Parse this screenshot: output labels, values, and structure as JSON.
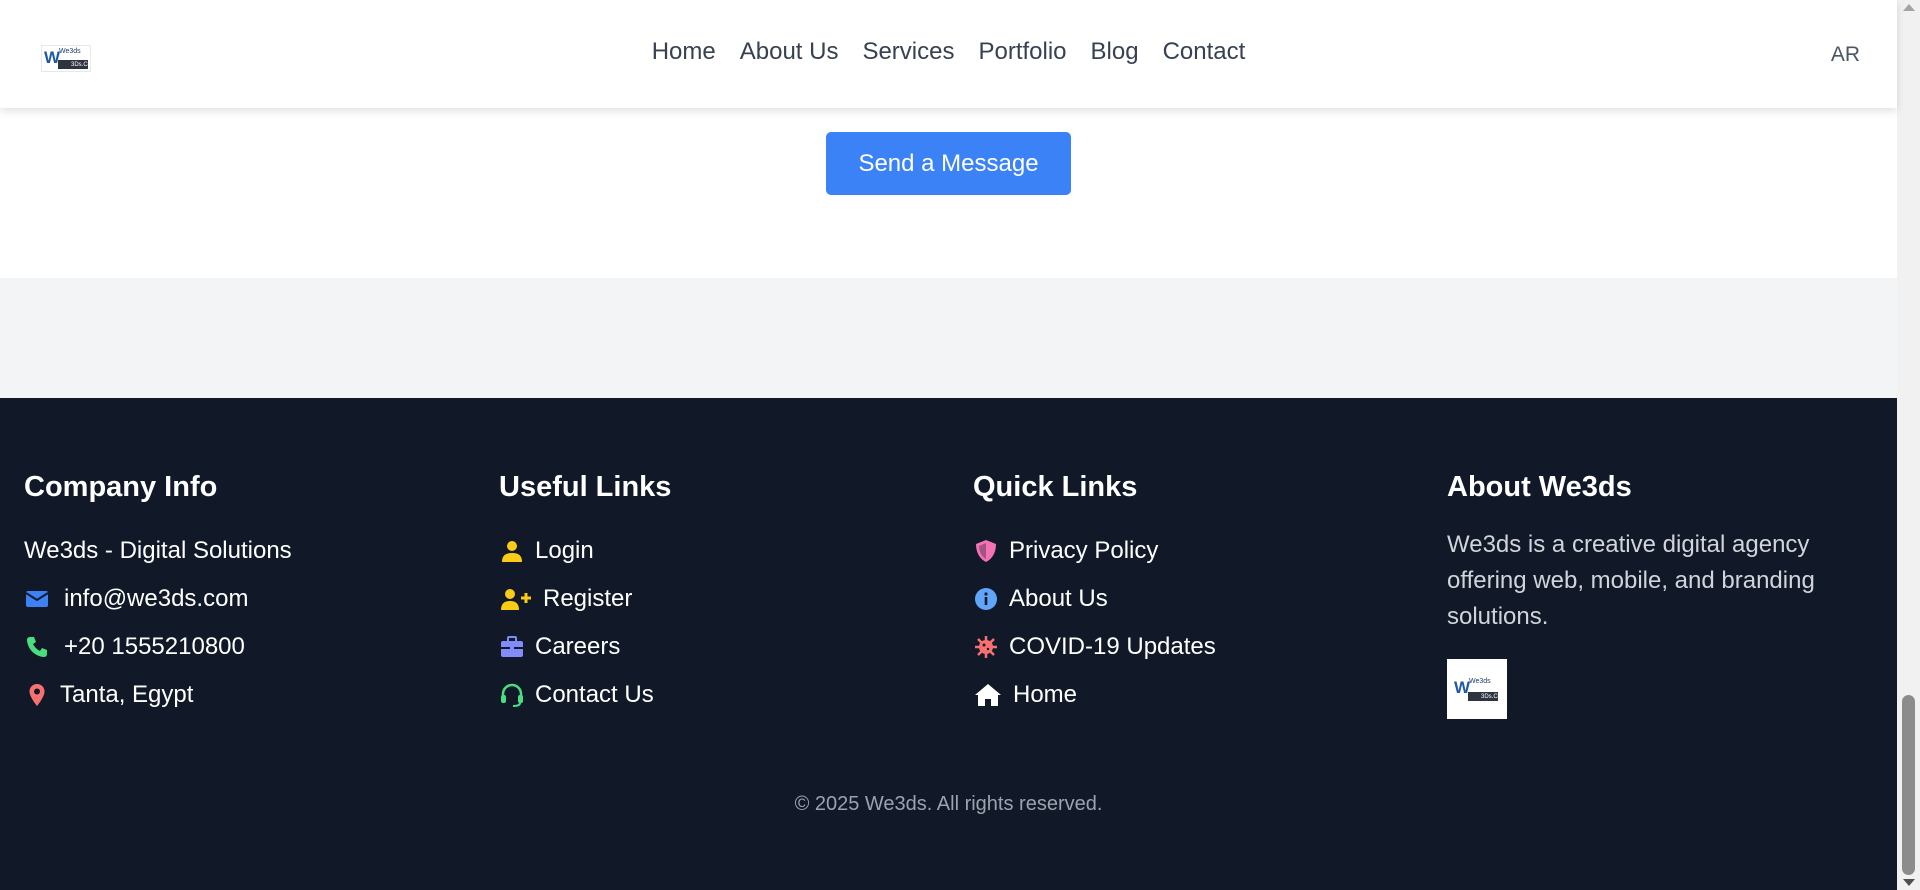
{
  "header": {
    "logo_text": "We3ds",
    "logo_sub": "3Ds.Co",
    "nav": [
      {
        "label": "Home"
      },
      {
        "label": "About Us"
      },
      {
        "label": "Services"
      },
      {
        "label": "Portfolio"
      },
      {
        "label": "Blog"
      },
      {
        "label": "Contact"
      }
    ],
    "lang_toggle": "AR"
  },
  "contact": {
    "send_label": "Send a Message"
  },
  "footer": {
    "company": {
      "title": "Company Info",
      "name": "We3ds - Digital Solutions",
      "email": "info@we3ds.com",
      "phone": "+20 1555210800",
      "location": "Tanta, Egypt"
    },
    "useful": {
      "title": "Useful Links",
      "items": [
        {
          "label": "Login",
          "icon": "user-icon"
        },
        {
          "label": "Register",
          "icon": "user-plus-icon"
        },
        {
          "label": "Careers",
          "icon": "briefcase-icon"
        },
        {
          "label": "Contact Us",
          "icon": "headset-icon"
        }
      ]
    },
    "quick": {
      "title": "Quick Links",
      "items": [
        {
          "label": "Privacy Policy",
          "icon": "shield-icon"
        },
        {
          "label": "About Us",
          "icon": "info-icon"
        },
        {
          "label": "COVID-19 Updates",
          "icon": "virus-icon"
        },
        {
          "label": "Home",
          "icon": "home-icon"
        }
      ]
    },
    "about": {
      "title": "About We3ds",
      "text": "We3ds is a creative digital agency offering web, mobile, and branding solutions."
    },
    "copyright": "© 2025 We3ds. All rights reserved."
  },
  "colors": {
    "accent": "#3b82f6",
    "footer_bg": "#111827",
    "email_icon": "#3b82f6",
    "phone_icon": "#4ade80",
    "location_icon": "#f87171",
    "user_icon": "#facc15",
    "briefcase_icon": "#818cf8",
    "headset_icon": "#4ade80",
    "shield_icon": "#f472b6",
    "info_icon": "#60a5fa",
    "virus_icon": "#f87171",
    "home_icon": "#ffffff"
  }
}
